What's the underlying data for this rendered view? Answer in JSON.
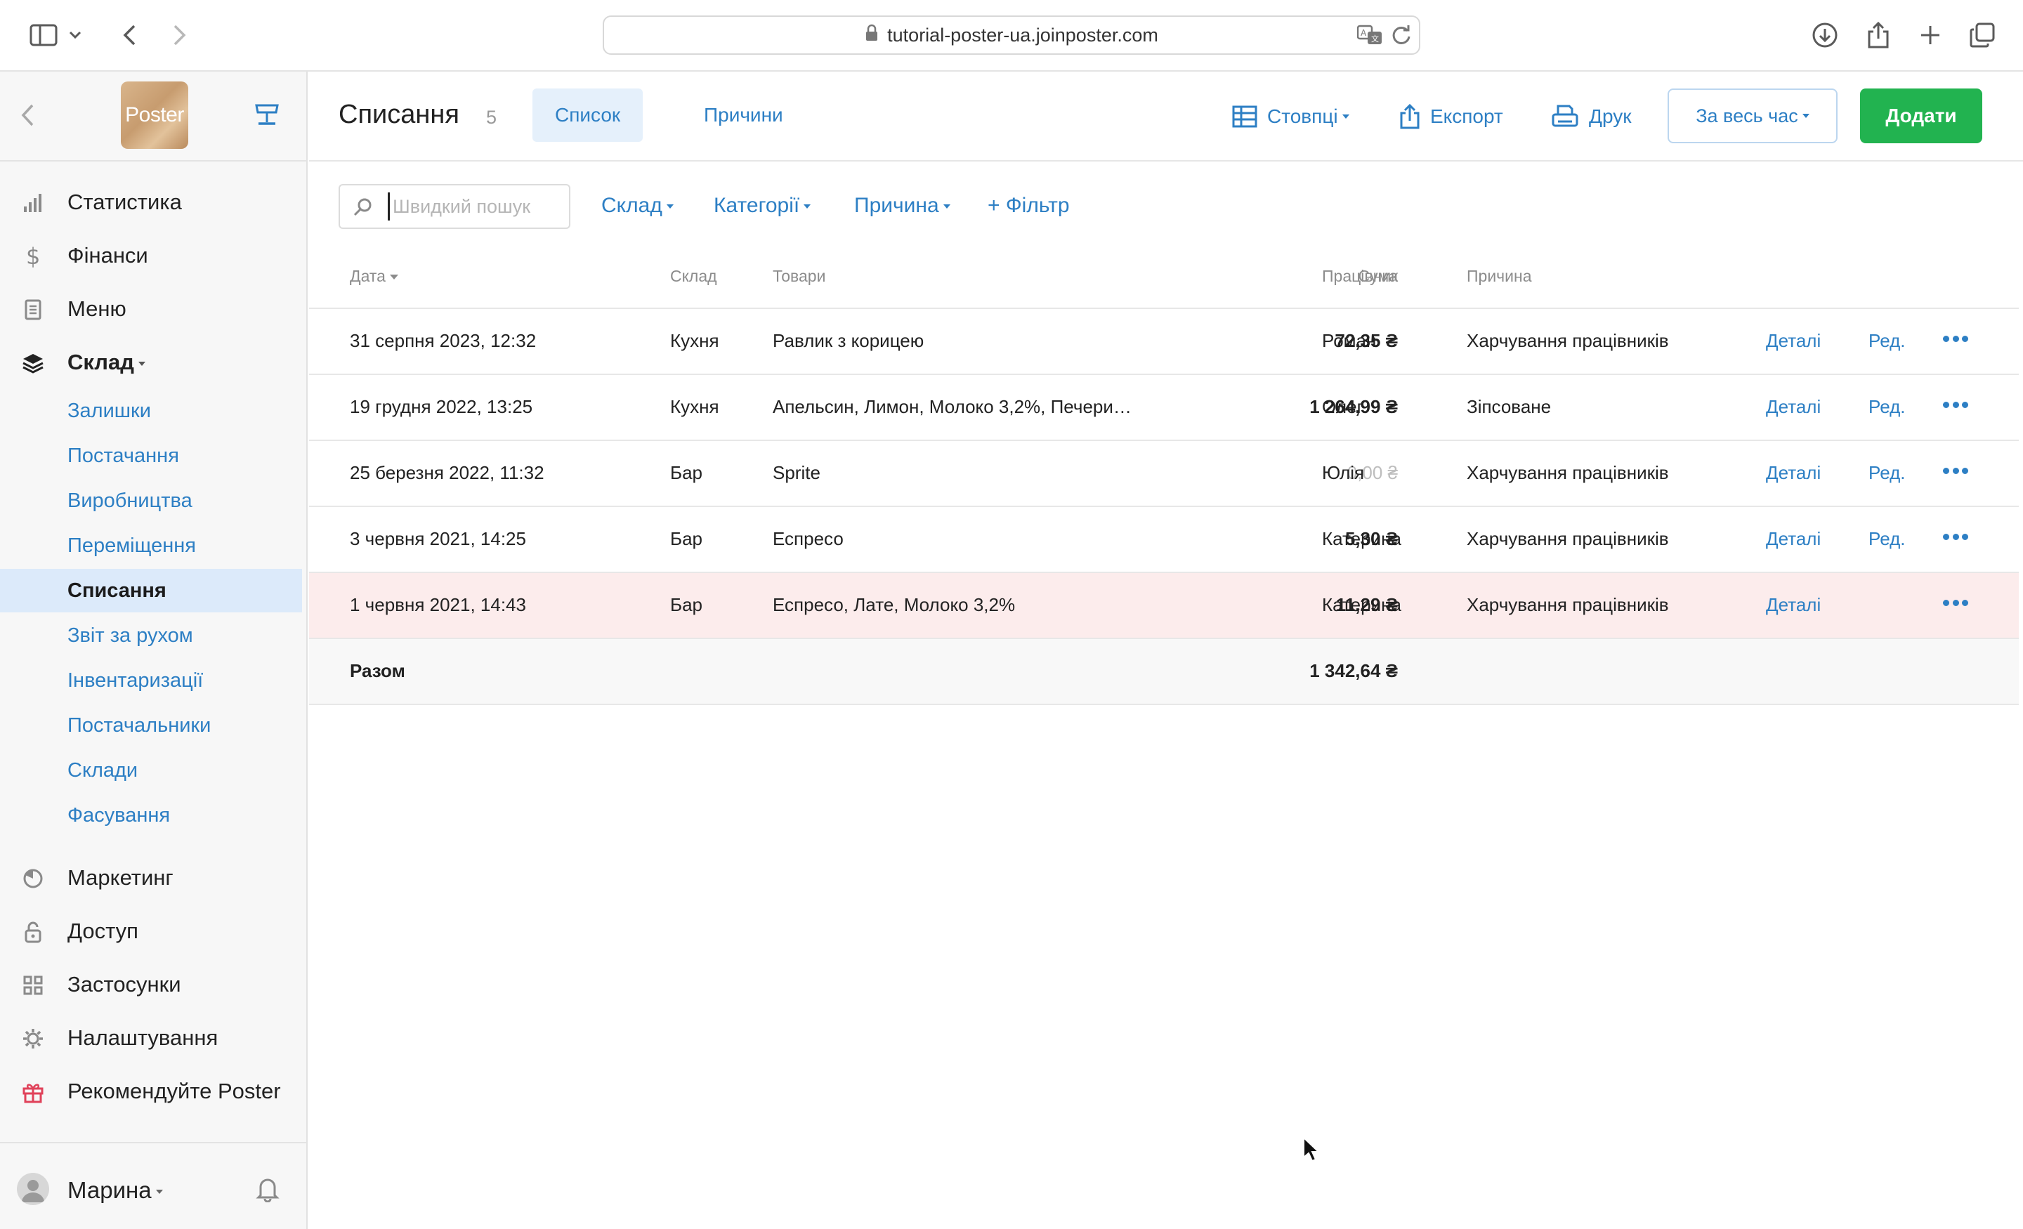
{
  "browser": {
    "url": "tutorial-poster-ua.joinposter.com"
  },
  "sidebar": {
    "logo_text": "Poster",
    "nav_top": [
      {
        "label": "Статистика",
        "icon": "bar-chart-icon"
      },
      {
        "label": "Фінанси",
        "icon": "dollar-icon"
      },
      {
        "label": "Меню",
        "icon": "document-icon"
      },
      {
        "label": "Склад",
        "icon": "layers-icon"
      }
    ],
    "warehouse_items": [
      {
        "label": "Залишки"
      },
      {
        "label": "Постачання"
      },
      {
        "label": "Виробництва"
      },
      {
        "label": "Переміщення"
      },
      {
        "label": "Списання"
      },
      {
        "label": "Звіт за рухом"
      },
      {
        "label": "Інвентаризації"
      },
      {
        "label": "Постачальники"
      },
      {
        "label": "Склади"
      },
      {
        "label": "Фасування"
      }
    ],
    "nav_bottom": [
      {
        "label": "Маркетинг",
        "icon": "pie-icon"
      },
      {
        "label": "Доступ",
        "icon": "lock-icon"
      },
      {
        "label": "Застосунки",
        "icon": "grid-icon"
      },
      {
        "label": "Налаштування",
        "icon": "gear-icon"
      },
      {
        "label": "Рекомендуйте Poster",
        "icon": "gift-icon"
      }
    ],
    "user": "Марина"
  },
  "header": {
    "title": "Списання",
    "count": "5",
    "tabs": [
      {
        "label": "Список"
      },
      {
        "label": "Причини"
      }
    ],
    "columns_label": "Стовпці",
    "export_label": "Експорт",
    "print_label": "Друк",
    "period_label": "За весь час",
    "add_label": "Додати"
  },
  "filters": {
    "search_placeholder": "Швидкий пошук",
    "warehouse": "Склад",
    "categories": "Категорії",
    "reason": "Причина",
    "add_filter": "+ Фільтр"
  },
  "table": {
    "headers": {
      "date": "Дата",
      "warehouse": "Склад",
      "goods": "Товари",
      "sum": "Сума",
      "employee": "Працівник",
      "reason": "Причина"
    },
    "rows": [
      {
        "date": "31 серпня 2023, 12:32",
        "warehouse": "Кухня",
        "goods": "Равлик з корицею",
        "sum": "72,35 ₴",
        "employee": "Роман",
        "reason": "Харчування працівників",
        "details": "Деталі",
        "edit": "Ред."
      },
      {
        "date": "19 грудня 2022, 13:25",
        "warehouse": "Кухня",
        "goods": "Апельсин, Лимон, Молоко 3,2%, Печери…",
        "sum": "1 264,99 ₴",
        "employee": "Олег",
        "reason": "Зіпсоване",
        "details": "Деталі",
        "edit": "Ред."
      },
      {
        "date": "25 березня 2022, 11:32",
        "warehouse": "Бар",
        "goods": "Sprite",
        "sum": "0,00 ₴",
        "employee": "Юлія",
        "reason": "Харчування працівників",
        "details": "Деталі",
        "edit": "Ред."
      },
      {
        "date": "3 червня 2021, 14:25",
        "warehouse": "Бар",
        "goods": "Еспресо",
        "sum": "5,30 ₴",
        "employee": "Катерина",
        "reason": "Харчування працівників",
        "details": "Деталі",
        "edit": "Ред."
      },
      {
        "date": "1 червня 2021, 14:43",
        "warehouse": "Бар",
        "goods": "Еспресо, Лате, Молоко 3,2%",
        "sum": "11,29 ₴",
        "employee": "Катерина",
        "reason": "Харчування працівників",
        "details": "Деталі",
        "edit": ""
      }
    ],
    "total_label": "Разом",
    "total_sum": "1 342,64 ₴"
  },
  "colors": {
    "accent": "#2d7fc4",
    "add_button": "#22b350",
    "active_nav_bg": "#dceafa",
    "warn_row_bg": "#fcecec"
  }
}
